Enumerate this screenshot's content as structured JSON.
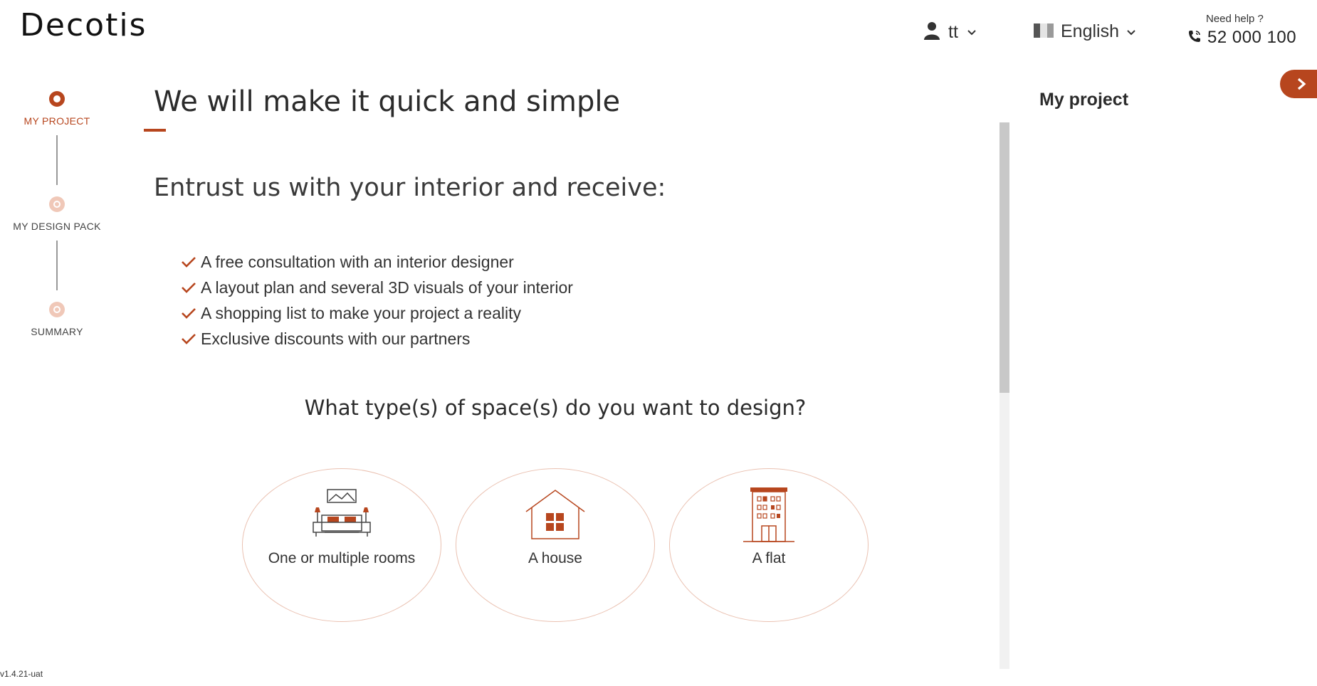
{
  "brand": {
    "logo_text": "Decotis",
    "accent_color": "#b7461e"
  },
  "header": {
    "user": {
      "name": "tt",
      "icon": "user-icon"
    },
    "language": {
      "selected": "English",
      "icon": "flag-icon"
    },
    "help": {
      "label": "Need help ?",
      "phone": "52 000 100",
      "icon": "phone-icon"
    }
  },
  "stepper": {
    "steps": [
      {
        "label": "MY PROJECT",
        "state": "active"
      },
      {
        "label": "MY DESIGN PACK",
        "state": "inactive"
      },
      {
        "label": "SUMMARY",
        "state": "inactive"
      }
    ]
  },
  "main": {
    "title": "We will make it quick and simple",
    "subtitle": "Entrust us with your interior and receive:",
    "benefits": [
      "A free consultation with an interior designer",
      "A layout plan and several 3D visuals of your interior",
      "A shopping list to make your project a reality",
      "Exclusive discounts with our partners"
    ],
    "question": "What type(s) of space(s) do you want to design?",
    "options": [
      {
        "label": "One or multiple rooms",
        "icon": "bedroom-icon"
      },
      {
        "label": "A house",
        "icon": "house-icon"
      },
      {
        "label": "A flat",
        "icon": "building-icon"
      }
    ]
  },
  "right_panel": {
    "title": "My project",
    "toggle_icon": "chevron-right-icon"
  },
  "footer": {
    "version": "v1.4.21-uat"
  }
}
